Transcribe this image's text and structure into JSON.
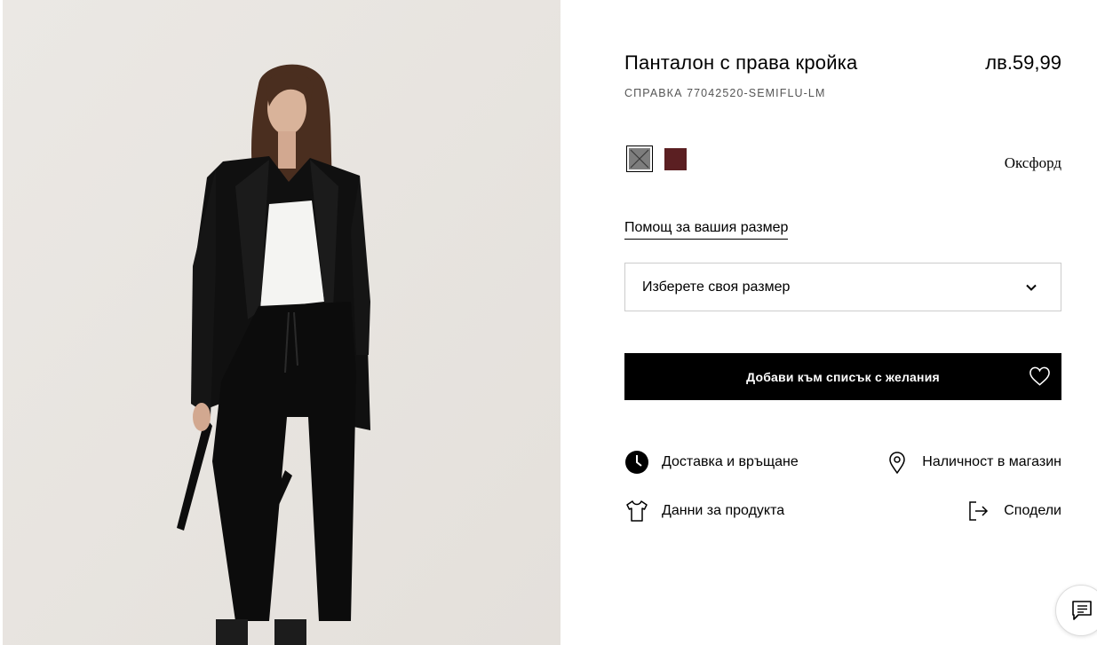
{
  "product": {
    "title": "Панталон с права кройка",
    "price": "лв.59,99",
    "reference": "СПРАВКА 77042520-SEMIFLU-LM",
    "image_alt": "Модел, облечен в черен костюм с бяла блуза",
    "colors": [
      {
        "name": "grey",
        "hex": "#7d7d7d",
        "selected": true
      },
      {
        "name": "burgundy",
        "hex": "#5b1f22",
        "selected": false
      }
    ],
    "selected_color_name": "Оксфорд"
  },
  "size": {
    "help_link": "Помощ за вашия размер",
    "select_placeholder": "Изберете своя размер"
  },
  "wishlist": {
    "button_label": "Добави към списък с желания"
  },
  "actions": {
    "delivery": "Доставка и връщане",
    "store_availability": "Наличност в магазин",
    "product_details": "Данни за продукта",
    "share": "Сподели"
  },
  "icons": {
    "delivery": "clock-icon",
    "store": "location-pin-icon",
    "details": "tshirt-icon",
    "share": "share-icon",
    "wishlist": "heart-icon",
    "dropdown": "chevron-down-icon",
    "chat": "chat-icon"
  }
}
